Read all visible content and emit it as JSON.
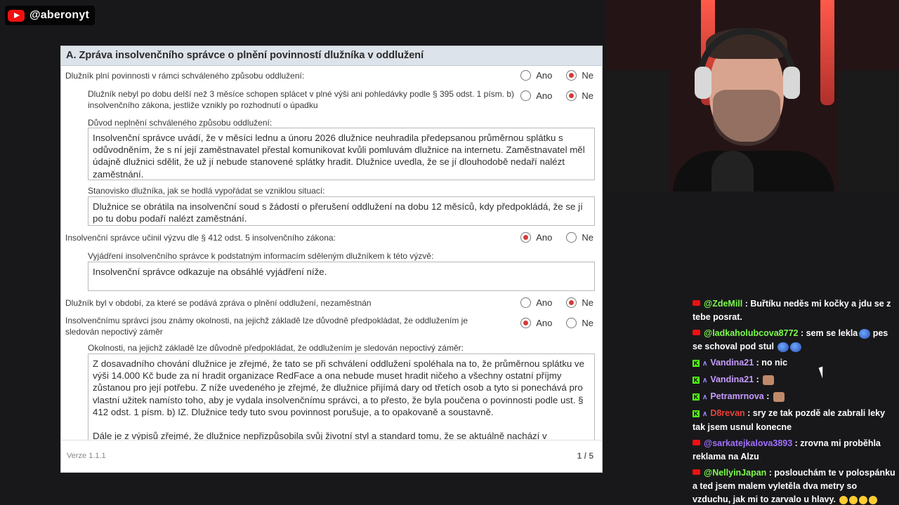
{
  "channel": {
    "handle": "@aberonyt"
  },
  "document": {
    "title": "A. Zpráva insolvenčního správce o plnění povinností dlužníka v oddlužení",
    "rows": [
      {
        "label": "Dlužník plní povinnosti v rámci schváleného způsobu oddlužení:",
        "selected": "Ne"
      },
      {
        "label": "Dlužník nebyl po dobu delší než 3 měsíce schopen splácet v plné výši ani pohledávky podle § 395 odst. 1 písm. b) insolvenčního zákona, jestliže vznikly po rozhodnutí o úpadku",
        "selected": "Ne"
      },
      {
        "label": "Insolvenční správce učinil výzvu dle § 412 odst. 5 insolvenčního zákona:",
        "selected": "Ano"
      },
      {
        "label": "Dlužník byl v období, za které se podává zpráva o plnění oddlužení, nezaměstnán",
        "selected": "Ne"
      },
      {
        "label": "Insolvenčnímu správci jsou známy okolnosti, na jejichž základě lze důvodně předpokládat, že oddlužením je sledován nepoctivý záměr",
        "selected": "Ano"
      }
    ],
    "fields": [
      {
        "label": "Důvod neplnění schváleného způsobu oddlužení:",
        "text": "Insolvenční správce uvádí, že v měsíci lednu a únoru 2026 dlužnice neuhradila předepsanou průměrnou splátku s odůvodněním, že s ní její zaměstnavatel přestal komunikovat kvůli pomluvám dlužnice na internetu. Zaměstnavatel měl údajně dlužnici sdělit, že už jí nebude stanovené splátky hradit. Dlužnice uvedla, že se jí dlouhodobě nedaří nalézt zaměstnání."
      },
      {
        "label": "Stanovisko dlužníka, jak se hodlá vypořádat se vzniklou situací:",
        "text": "Dlužnice se obrátila na insolvenční soud s žádostí o přerušení oddlužení na dobu 12 měsíců, kdy předpokládá, že se jí po tu dobu podaří nalézt zaměstnání."
      },
      {
        "label": "Vyjádření insolvenčního správce k podstatným informacím sděleným dlužníkem k této výzvě:",
        "text": "Insolvenční správce odkazuje na obsáhlé vyjádření níže."
      },
      {
        "label": "Okolnosti, na jejichž základě lze důvodně předpokládat, že oddlužením je sledován nepoctivý záměr:",
        "text": "Z dosavadního chování dlužnice je zřejmé, že tato se při schválení oddlužení spoléhala na to, že průměrnou splátku ve výši 14.000 Kč bude za ní hradit organizace RedFace a ona nebude muset hradit ničeho a všechny ostatní příjmy zůstanou pro její potřebu. Z níže uvedeného je zřejmé, že dlužnice přijímá dary od třetích osob a tyto si ponechává pro vlastní užitek namísto toho, aby je vydala insolvenčnímu správci, a to přesto, že byla poučena o povinnosti podle ust. § 412 odst. 1 písm. b) IZ. Dlužnice tedy tuto svou povinnost porušuje, a to opakovaně a soustavně.",
        "text2": "Dále je z výpisů zřejmé, že dlužnice nepřizpůsobila svůj životní styl a standard tomu, že se aktuálně nachází v"
      }
    ],
    "options": {
      "yes": "Ano",
      "no": "Ne"
    },
    "version": "Verze  1.1.1",
    "page": "1 / 5"
  },
  "chat": [
    {
      "platform": "youtube",
      "user": "@ZdeMill",
      "color": "#7cfc4a",
      "text": " : Buřtíku neděs mi kočky a jdu se z tebe posrat."
    },
    {
      "platform": "youtube",
      "user": "@ladkaholubcova8772",
      "color": "#7cfc4a",
      "text": " : sem se lekla",
      "emotes": [
        "blue"
      ],
      "text2": " pes se schoval pod stul ",
      "emotes2": [
        "blue",
        "blue"
      ]
    },
    {
      "platform": "kick",
      "user": "Vandina21",
      "color": "#c79bff",
      "text": " : no nic"
    },
    {
      "platform": "kick",
      "user": "Vandina21",
      "color": "#c79bff",
      "text": " : ",
      "emotes": [
        "pic"
      ]
    },
    {
      "platform": "kick",
      "user": "Petramrnova",
      "color": "#c79bff",
      "text": " : ",
      "emotes": [
        "pic"
      ]
    },
    {
      "platform": "kick",
      "user": "D8revan",
      "color": "#e8423a",
      "text": " : sry ze tak pozdě ale zabrali leky tak jsem usnul konecne"
    },
    {
      "platform": "youtube",
      "user": "@sarkatejkalova3893",
      "color": "#a070ff",
      "text": " : zrovna mi proběhla reklama na Alzu"
    },
    {
      "platform": "youtube",
      "user": "@NellyinJapan",
      "color": "#7cfc4a",
      "text": " : poslouchám te v polospánku a ted jsem malem vyletěla dva metry so vzduchu, jak mi to zarvalo u hlavy. ",
      "emotes": [
        "laugh",
        "laugh",
        "laugh",
        "laugh"
      ]
    }
  ]
}
